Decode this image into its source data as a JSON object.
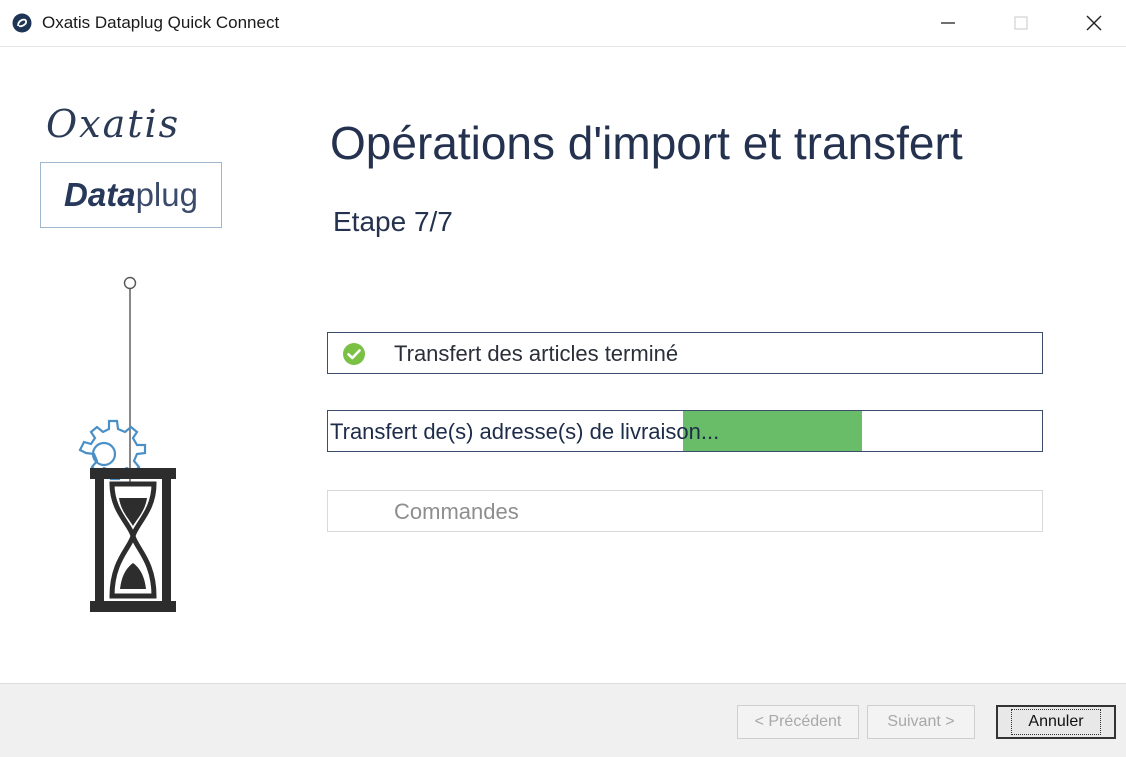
{
  "window": {
    "title": "Oxatis Dataplug Quick Connect",
    "controls": {
      "minimize": "—",
      "maximize": "☐",
      "close": "✕"
    }
  },
  "logo": {
    "script_text": "Oxatis",
    "dataplug_bold": "Data",
    "dataplug_rest": "plug"
  },
  "header": {
    "title": "Opérations d'import et transfert",
    "step": "Etape 7/7"
  },
  "tasks": [
    {
      "label": "Transfert des articles terminé",
      "status": "done",
      "icon": "check-circle-icon"
    },
    {
      "label": "Transfert de(s) adresse(s) de livraison...",
      "status": "in-progress",
      "progress": 0.25
    },
    {
      "label": "Commandes",
      "status": "pending"
    }
  ],
  "footer": {
    "prev_label": "< Précédent",
    "next_label": "Suivant >",
    "cancel_label": "Annuler"
  },
  "colors": {
    "accent": "#24324f",
    "progress": "#69bd68",
    "check": "#7ac143"
  }
}
